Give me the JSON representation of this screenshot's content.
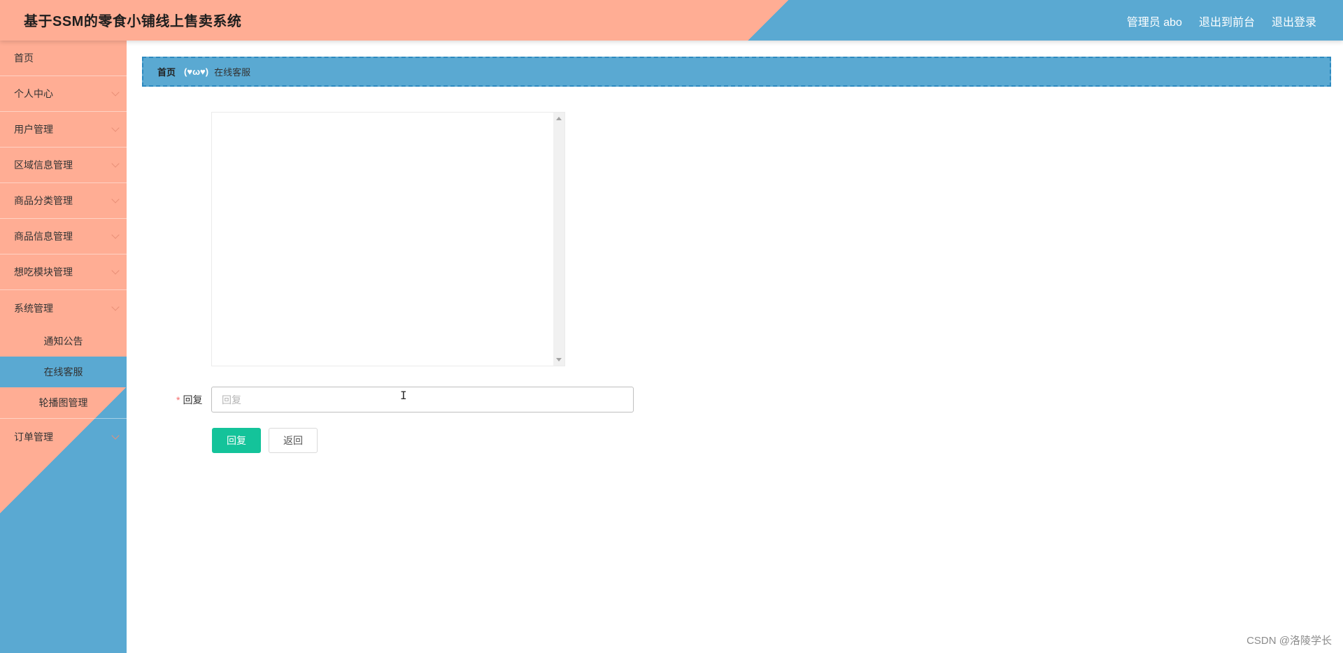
{
  "header": {
    "title": "基于SSM的零食小铺线上售卖系统",
    "user_label": "管理员 abo",
    "front_link": "退出到前台",
    "logout_link": "退出登录"
  },
  "sidebar": {
    "items": [
      {
        "label": "首页"
      },
      {
        "label": "个人中心"
      },
      {
        "label": "用户管理"
      },
      {
        "label": "区域信息管理"
      },
      {
        "label": "商品分类管理"
      },
      {
        "label": "商品信息管理"
      },
      {
        "label": "想吃模块管理"
      },
      {
        "label": "系统管理"
      }
    ],
    "submenu": [
      {
        "label": "通知公告"
      },
      {
        "label": "在线客服"
      },
      {
        "label": "轮播图管理"
      }
    ],
    "last_item": {
      "label": "订单管理"
    }
  },
  "breadcrumb": {
    "home": "首页",
    "separator": "(♥ω♥)",
    "current": "在线客服"
  },
  "form": {
    "reply_label": "回复",
    "reply_placeholder": "回复",
    "reply_value": "",
    "submit_label": "回复",
    "back_label": "返回"
  },
  "watermark": "CSDN @洛陵学长",
  "colors": {
    "salmon": "#ffad94",
    "blue": "#5aa9d2",
    "primary": "#14c39a"
  }
}
